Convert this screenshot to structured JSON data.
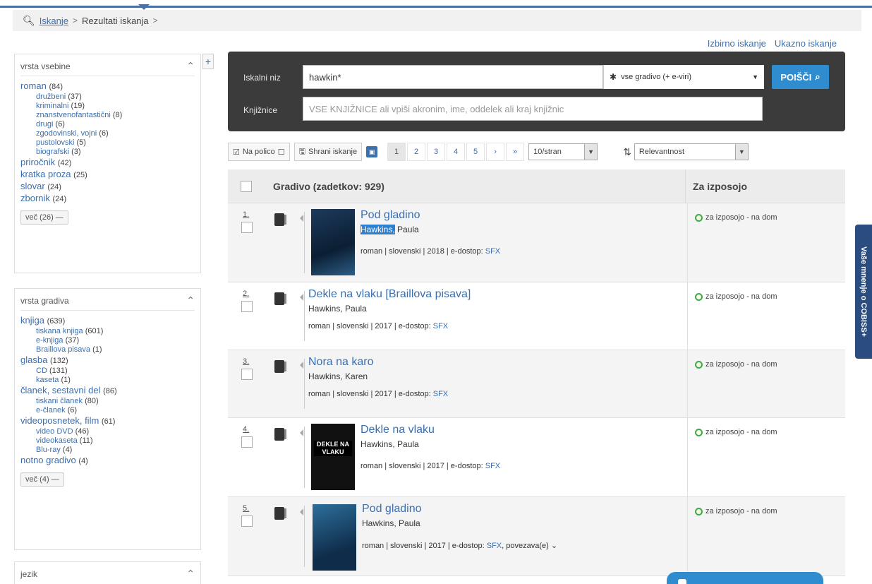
{
  "breadcrumb": {
    "search_link": "Iskanje",
    "sep": ">",
    "current": "Rezultati iskanja"
  },
  "top_links": {
    "selective": "Izbirno iskanje",
    "command": "Ukazno iskanje"
  },
  "facets": {
    "content_type": {
      "title": "vrsta vsebine",
      "items": [
        {
          "label": "roman",
          "count": "(84)",
          "level": 1
        },
        {
          "label": "družbeni",
          "count": "(37)",
          "level": 2
        },
        {
          "label": "kriminalni",
          "count": "(19)",
          "level": 2
        },
        {
          "label": "znanstvenofantastični",
          "count": "(8)",
          "level": 2
        },
        {
          "label": "drugi",
          "count": "(6)",
          "level": 2
        },
        {
          "label": "zgodovinski, vojni",
          "count": "(6)",
          "level": 2
        },
        {
          "label": "pustolovski",
          "count": "(5)",
          "level": 2
        },
        {
          "label": "biografski",
          "count": "(3)",
          "level": 2
        },
        {
          "label": "priročnik",
          "count": "(42)",
          "level": 1
        },
        {
          "label": "kratka proza",
          "count": "(25)",
          "level": 1
        },
        {
          "label": "slovar",
          "count": "(24)",
          "level": 1
        },
        {
          "label": "zbornik",
          "count": "(24)",
          "level": 1
        }
      ],
      "more": "več (26) —"
    },
    "material_type": {
      "title": "vrsta gradiva",
      "items": [
        {
          "label": "knjiga",
          "count": "(639)",
          "level": 1
        },
        {
          "label": "tiskana knjiga",
          "count": "(601)",
          "level": 2
        },
        {
          "label": "e-knjiga",
          "count": "(37)",
          "level": 2
        },
        {
          "label": "Braillova pisava",
          "count": "(1)",
          "level": 2
        },
        {
          "label": "glasba",
          "count": "(132)",
          "level": 1
        },
        {
          "label": "CD",
          "count": "(131)",
          "level": 2
        },
        {
          "label": "kaseta",
          "count": "(1)",
          "level": 2
        },
        {
          "label": "članek, sestavni del",
          "count": "(86)",
          "level": 1
        },
        {
          "label": "tiskani članek",
          "count": "(80)",
          "level": 2
        },
        {
          "label": "e-članek",
          "count": "(6)",
          "level": 2
        },
        {
          "label": "videoposnetek, film",
          "count": "(61)",
          "level": 1
        },
        {
          "label": "video DVD",
          "count": "(46)",
          "level": 2
        },
        {
          "label": "videokaseta",
          "count": "(11)",
          "level": 2
        },
        {
          "label": "Blu-ray",
          "count": "(4)",
          "level": 2
        },
        {
          "label": "notno gradivo",
          "count": "(4)",
          "level": 1
        }
      ],
      "more": "več (4) —"
    },
    "language": {
      "title": "jezik"
    }
  },
  "search": {
    "query_label": "Iskalni niz",
    "query_value": "hawkin*",
    "material_select": "vse gradivo (+ e-viri)",
    "button": "POIŠČI",
    "libraries_label": "Knjižnice",
    "libraries_placeholder": "VSE KNJIŽNICE ali vpiši akronim, ime, oddelek ali kraj knjižnic"
  },
  "toolbar": {
    "shelf": "Na polico",
    "save_search": "Shrani iskanje",
    "pages": [
      "1",
      "2",
      "3",
      "4",
      "5",
      "›",
      "»"
    ],
    "per_page": "10/stran",
    "sort": "Relevantnost"
  },
  "results_header": {
    "title": "Gradivo (zadetkov: 929)",
    "avail": "Za izposojo"
  },
  "results": [
    {
      "num": "1.",
      "title": "Pod gladino",
      "author_hl": "Hawkins,",
      "author_rest": " Paula",
      "meta": "roman | slovenski | 2018 | e-dostop: ",
      "sfx": "SFX",
      "extra": "",
      "avail": "za izposojo - na dom"
    },
    {
      "num": "2.",
      "title": "Dekle na vlaku [Braillova pisava]",
      "author": "Hawkins, Paula",
      "meta": "roman | slovenski | 2017 | e-dostop: ",
      "sfx": "SFX",
      "extra": "",
      "avail": "za izposojo - na dom"
    },
    {
      "num": "3.",
      "title": "Nora na karo",
      "author": "Hawkins, Karen",
      "meta": "roman | slovenski | 2017 | e-dostop: ",
      "sfx": "SFX",
      "extra": "",
      "avail": "za izposojo - na dom"
    },
    {
      "num": "4.",
      "title": "Dekle na vlaku",
      "author": "Hawkins, Paula",
      "meta": "roman | slovenski | 2017 | e-dostop: ",
      "sfx": "SFX",
      "extra": "",
      "avail": "za izposojo - na dom",
      "cover_text": "DEKLE NA VLAKU"
    },
    {
      "num": "5.",
      "title": "Pod gladino",
      "author": "Hawkins, Paula",
      "meta": "roman | slovenski | 2017 | e-dostop: ",
      "sfx": "SFX",
      "extra": ",  povezava(e) ⌄",
      "avail": "za izposojo - na dom"
    }
  ],
  "side_tab": "Vaše mnenje o COBISS+"
}
